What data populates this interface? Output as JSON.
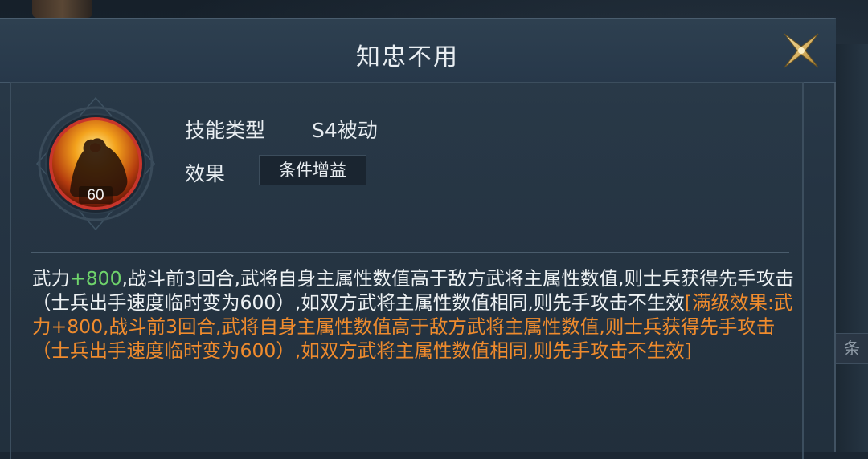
{
  "dialog": {
    "title": "知忠不用"
  },
  "skill": {
    "level": "60",
    "type_label": "技能类型",
    "type_value": "S4被动",
    "effect_label": "效果",
    "effect_badge": "条件增益"
  },
  "description": {
    "part1": "武力",
    "bonus": "+800",
    "part2": ",战斗前3回合,武将自身主属性数值高于敌方武将主属性数值,则士兵获得先手攻击（士兵出手速度临时变为600）,如双方武将主属性数值相同,则先手攻击不生效",
    "max_level": "[满级效果:武力+800,战斗前3回合,武将自身主属性数值高于敌方武将主属性数值,则士兵获得先手攻击（士兵出手速度临时变为600）,如双方武将主属性数值相同,则先手攻击不生效]"
  },
  "background": {
    "right_chip": "条"
  },
  "colors": {
    "bonus_green": "#6fd46b",
    "max_level_orange": "#ef8b2d",
    "close_gold": "#e6c27a",
    "icon_ring_red": "#c8352b"
  },
  "icons": {
    "close": "close-icon",
    "skill": "skill-portrait-icon"
  }
}
